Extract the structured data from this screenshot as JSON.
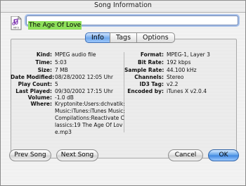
{
  "window": {
    "title": "Song Information"
  },
  "header": {
    "file_icon": "music-file-icon",
    "file_icon_label": "MP3",
    "song_name": "The Age Of Love"
  },
  "tabs": [
    {
      "label": "Info",
      "selected": true
    },
    {
      "label": "Tags",
      "selected": false
    },
    {
      "label": "Options",
      "selected": false
    }
  ],
  "info_left": [
    {
      "label": "Kind:",
      "value": "MPEG audio file"
    },
    {
      "label": "Time:",
      "value": "5:03"
    },
    {
      "label": "Size:",
      "value": "7 MB"
    },
    {
      "label": "Date Modified:",
      "value": "08/28/2002 12:05 Uhr"
    },
    {
      "label": "Play Count:",
      "value": "5"
    },
    {
      "label": "Last Played:",
      "value": "09/30/2002 17:15 Uhr"
    },
    {
      "label": "Volume:",
      "value": "-1.0 dB"
    }
  ],
  "where": {
    "label": "Where:",
    "value": "Kryptonite:Users:dchvatik:Music:iTunes:iTunes Music:Compilations:Reactivate Classics:19 The Age Of Love.mp3"
  },
  "info_right": [
    {
      "label": "Format:",
      "value": "MPEG-1, Layer 3"
    },
    {
      "label": "Bit Rate:",
      "value": "192 kbps"
    },
    {
      "label": "Sample Rate:",
      "value": "44.100 kHz"
    },
    {
      "label": "Channels:",
      "value": "Stereo"
    },
    {
      "label": "ID3 Tag:",
      "value": "v2.2"
    },
    {
      "label": "Encoded by:",
      "value": "iTunes X v2.0.4"
    }
  ],
  "buttons": {
    "prev": "Prev Song",
    "next": "Next Song",
    "cancel": "Cancel",
    "ok": "OK"
  },
  "colors": {
    "selection_highlight": "#8ee05a",
    "accent_blue": "#5a9de8"
  }
}
